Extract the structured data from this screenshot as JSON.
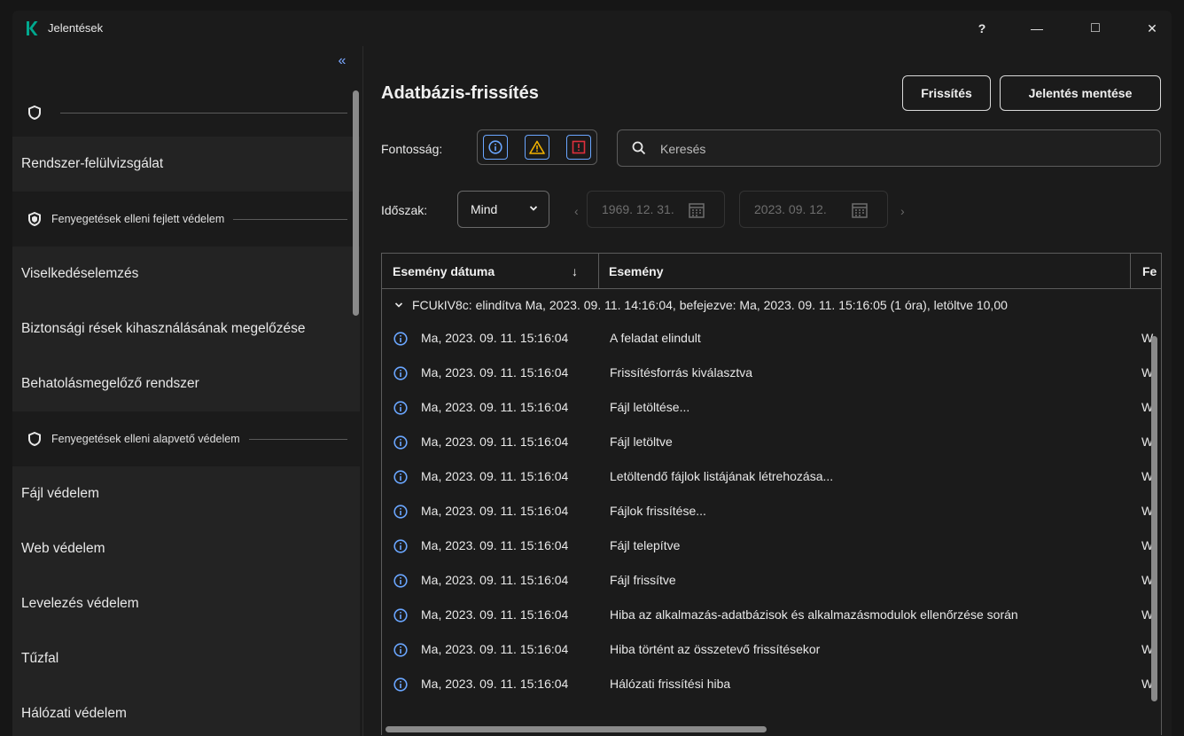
{
  "window": {
    "title": "Jelentések",
    "help": "?",
    "minimize": "—",
    "maximize": "□",
    "close": "✕"
  },
  "sidebar": {
    "collapse": "«",
    "groups": [
      {
        "label": ""
      },
      {
        "label": "Fenyegetések elleni fejlett védelem"
      },
      {
        "label": "Fenyegetések elleni alapvető védelem"
      }
    ],
    "items": [
      {
        "label": "Rendszer-felülvizsgálat"
      },
      {
        "label": "Viselkedéselemzés"
      },
      {
        "label": "Biztonsági rések kihasználásának megelőzése"
      },
      {
        "label": "Behatolásmegelőző rendszer"
      },
      {
        "label": "Fájl védelem"
      },
      {
        "label": "Web védelem"
      },
      {
        "label": "Levelezés védelem"
      },
      {
        "label": "Tűzfal"
      },
      {
        "label": "Hálózati védelem"
      }
    ]
  },
  "main": {
    "title": "Adatbázis-frissítés",
    "refresh_button": "Frissítés",
    "save_button": "Jelentés mentése",
    "severity_label": "Fontosság:",
    "search_placeholder": "Keresés",
    "period_label": "Időszak:",
    "period_value": "Mind",
    "date_from": "1969. 12. 31.",
    "date_to": "2023. 09. 12."
  },
  "table": {
    "columns": [
      "Esemény dátuma",
      "Esemény",
      "Fe"
    ],
    "sort_icon": "↓",
    "group_row": "FCUkIV8c: elindítva Ma, 2023. 09. 11. 14:16:04, befejezve: Ma, 2023. 09. 11. 15:16:05 (1 óra), letöltve 10,00",
    "rows": [
      {
        "date": "Ma, 2023. 09. 11. 15:16:04",
        "event": "A feladat elindult",
        "trunc": "W"
      },
      {
        "date": "Ma, 2023. 09. 11. 15:16:04",
        "event": "Frissítésforrás kiválasztva",
        "trunc": "W"
      },
      {
        "date": "Ma, 2023. 09. 11. 15:16:04",
        "event": "Fájl letöltése...",
        "trunc": "W"
      },
      {
        "date": "Ma, 2023. 09. 11. 15:16:04",
        "event": "Fájl letöltve",
        "trunc": "W"
      },
      {
        "date": "Ma, 2023. 09. 11. 15:16:04",
        "event": "Letöltendő fájlok listájának létrehozása...",
        "trunc": "W"
      },
      {
        "date": "Ma, 2023. 09. 11. 15:16:04",
        "event": "Fájlok frissítése...",
        "trunc": "W"
      },
      {
        "date": "Ma, 2023. 09. 11. 15:16:04",
        "event": "Fájl telepítve",
        "trunc": "W"
      },
      {
        "date": "Ma, 2023. 09. 11. 15:16:04",
        "event": "Fájl frissítve",
        "trunc": "W"
      },
      {
        "date": "Ma, 2023. 09. 11. 15:16:04",
        "event": "Hiba az alkalmazás-adatbázisok és alkalmazásmodulok ellenőrzése során",
        "trunc": "W"
      },
      {
        "date": "Ma, 2023. 09. 11. 15:16:04",
        "event": "Hiba történt az összetevő frissítésekor",
        "trunc": "W"
      },
      {
        "date": "Ma, 2023. 09. 11. 15:16:04",
        "event": "Hálózati frissítési hiba",
        "trunc": "W"
      }
    ]
  },
  "icons": {
    "app_logo": "kaspersky-k-icon",
    "shield": "shield-icon",
    "info": "info-icon",
    "warning": "warning-icon",
    "error": "error-icon",
    "search": "search-icon",
    "calendar": "calendar-icon",
    "chevron": "chevron-down-icon"
  },
  "colors": {
    "brand": "#00a88e",
    "accent": "#6aa6ff",
    "warning": "#f2b200",
    "error": "#e0303c"
  }
}
